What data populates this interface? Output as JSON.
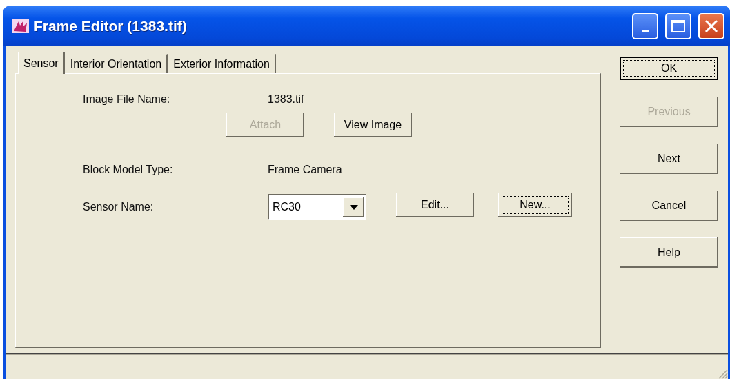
{
  "window": {
    "title": "Frame Editor (1383.tif)"
  },
  "tabs": [
    {
      "label": "Sensor",
      "selected": true
    },
    {
      "label": "Interior Orientation",
      "selected": false
    },
    {
      "label": "Exterior Information",
      "selected": false
    }
  ],
  "image_file": {
    "label": "Image File Name:",
    "value": "1383.tif",
    "buttons": [
      {
        "label": "Attach",
        "disabled": true,
        "focused": false
      },
      {
        "label": "View Image",
        "disabled": false,
        "focused": false
      }
    ]
  },
  "block_model": {
    "label": "Block Model Type:",
    "value": "Frame Camera"
  },
  "sensor": {
    "label": "Sensor Name:",
    "value": "RC30",
    "buttons": [
      {
        "label": "Edit...",
        "disabled": false,
        "focused": false
      },
      {
        "label": "New...",
        "disabled": false,
        "focused": true
      }
    ]
  },
  "side_buttons": [
    {
      "label": "OK",
      "disabled": false,
      "focused": true
    },
    {
      "label": "Previous",
      "disabled": true,
      "focused": false
    },
    {
      "label": "Next",
      "disabled": false,
      "focused": false
    },
    {
      "label": "Cancel",
      "disabled": false,
      "focused": false
    },
    {
      "label": "Help",
      "disabled": false,
      "focused": false
    }
  ]
}
